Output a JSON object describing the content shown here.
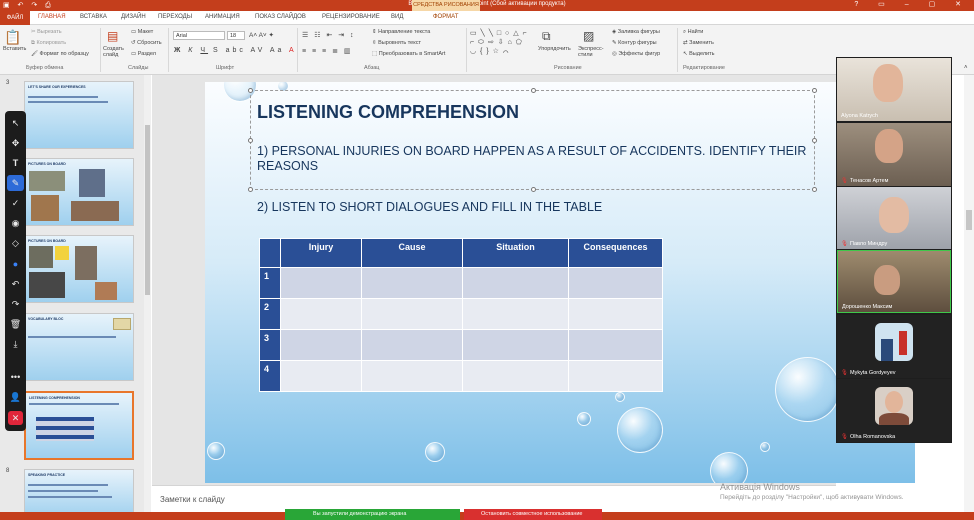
{
  "titlebar": {
    "title": "Відкр. зан. №27 - PowerPoint (Сбой активации продукта)",
    "context_tab": "СРЕДСТВА РИСОВАНИЯ"
  },
  "tabs": [
    "ФАЙЛ",
    "ГЛАВНАЯ",
    "ВСТАВКА",
    "ДИЗАЙН",
    "ПЕРЕХОДЫ",
    "АНИМАЦИЯ",
    "ПОКАЗ СЛАЙДОВ",
    "РЕЦЕНЗИРОВАНИЕ",
    "ВИД",
    "ФОРМАТ"
  ],
  "ribbon": {
    "clipboard": {
      "paste": "Вставить",
      "cut": "Вырезать",
      "copy": "Копировать",
      "format_painter": "Формат по образцу",
      "label": "Буфер обмена"
    },
    "slides": {
      "new_slide": "Создать слайд",
      "layout": "Макет",
      "reset": "Сбросить",
      "section": "Раздел",
      "label": "Слайды"
    },
    "font": {
      "name": "Arial",
      "size": "18",
      "label": "Шрифт"
    },
    "paragraph": {
      "text_direction": "Направление текста",
      "align_text": "Выровнять текст",
      "smartart": "Преобразовать в SmartArt",
      "label": "Абзац"
    },
    "drawing": {
      "arrange": "Упорядочить",
      "quick_styles": "Экспресс-стили",
      "fill": "Заливка фигуры",
      "outline": "Контур фигуры",
      "effects": "Эффекты фигур",
      "label": "Рисование"
    },
    "editing": {
      "find": "Найти",
      "replace": "Заменить",
      "select": "Выделить",
      "label": "Редактирование"
    }
  },
  "thumbnails": [
    {
      "number": "3",
      "title": "LET'S SHARE OUR EXPERIENCES"
    },
    {
      "number": "",
      "title": "PICTURES ON BOARD"
    },
    {
      "number": "",
      "title": "PICTURES ON BOARD"
    },
    {
      "number": "",
      "title": "VOCABULARY BLOC"
    },
    {
      "number": "",
      "title": "LISTENING COMPREHENSION"
    },
    {
      "number": "8",
      "title": "SPEAKING PRACTICE"
    }
  ],
  "slide": {
    "title": "LISTENING COMPREHENSION",
    "q1": "1) PERSONAL INJURIES ON BOARD HAPPEN AS A RESULT OF ACCIDENTS. IDENTIFY THEIR REASONS",
    "q2": "2) LISTEN TO SHORT DIALOGUES AND FILL IN THE TABLE",
    "table": {
      "headers": [
        "",
        "Injury",
        "Cause",
        "Situation",
        "Consequences"
      ],
      "rows": [
        "1",
        "2",
        "3",
        "4"
      ]
    }
  },
  "notes_placeholder": "Заметки к слайду",
  "statusbar": {
    "sharing": "Вы запустили демонстрацию экрана",
    "stop": "Остановить совместное использование"
  },
  "watermark": {
    "line1": "Активація Windows",
    "line2": "Перейдіть до розділу \"Настройки\", щоб активувати Windows."
  },
  "participants": [
    {
      "name": "Alyona Katrych",
      "kind": "video"
    },
    {
      "name": "Тенасов Артем",
      "kind": "video"
    },
    {
      "name": "Павло Миндру",
      "kind": "video"
    },
    {
      "name": "Дорошенко Максим",
      "kind": "video"
    },
    {
      "name": "Mykyta Gordyeyev",
      "kind": "avatar"
    },
    {
      "name": "Olha Romanovska",
      "kind": "avatar"
    }
  ],
  "colors": {
    "accent": "#c43e1c",
    "table_header": "#2a4f96",
    "slide_text": "#17365d",
    "share_green": "#29a637",
    "share_red": "#d9302f"
  }
}
